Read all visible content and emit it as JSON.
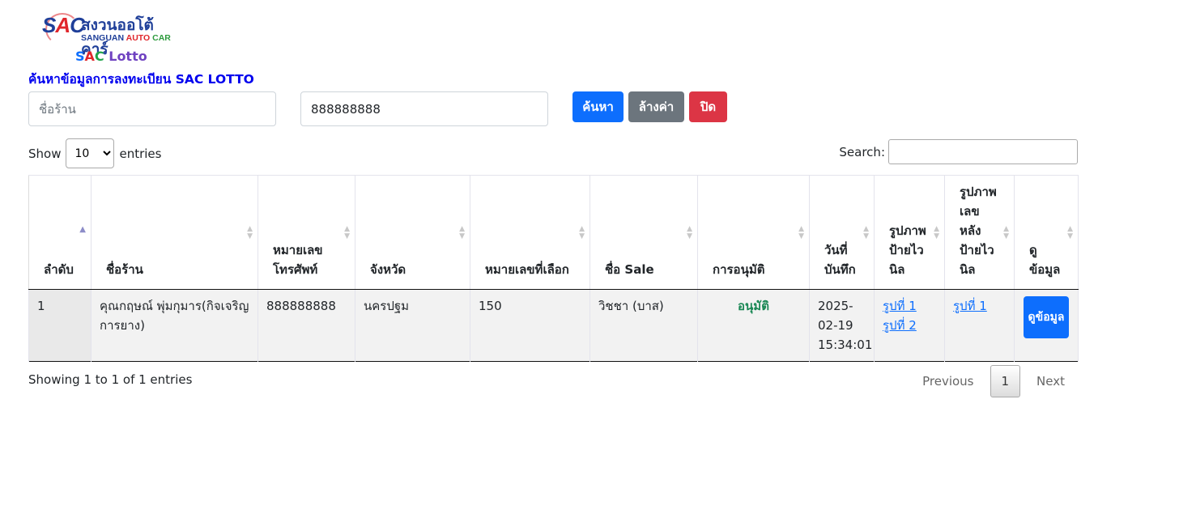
{
  "logo": {
    "mark_s": "S",
    "mark_a": "A",
    "mark_c": "C",
    "thai": "สงวนออโต้คาร์",
    "en_1": "SANGUAN",
    "en_2": "AUTO",
    "en_3": "CAR"
  },
  "brand": {
    "c1": "S",
    "c2": "A",
    "c3": "C",
    "rest": " Lotto"
  },
  "page_title": "ค้นหาข้อมูลการลงทะเบียน SAC LOTTO",
  "search_form": {
    "shop_placeholder": "ชื่อร้าน",
    "shop_value": "",
    "phone_value": "888888888",
    "search_label": "ค้นหา",
    "clear_label": "ล้างค่า",
    "close_label": "ปิด"
  },
  "table_controls": {
    "show_label": "Show",
    "entries_label": "entries",
    "length_options": [
      "10"
    ],
    "length_selected": "10",
    "search_label": "Search:"
  },
  "table": {
    "headers": [
      "ลำดับ",
      "ชื่อร้าน",
      "หมายเลขโทรศัพท์",
      "จังหวัด",
      "หมายเลขที่เลือก",
      "ชื่อ Sale",
      "การอนุมัติ",
      "วันที่บันทึก",
      "รูปภาพป้ายไวนิล",
      "รูปภาพเลขหลังป้ายไวนิล",
      "ดูข้อมูล"
    ],
    "rows": [
      {
        "no": "1",
        "shop": "คุณกฤษณ์ พุ่มกุมาร(กิจเจริญการยาง)",
        "phone": "888888888",
        "province": "นครปฐม",
        "number": "150",
        "sale": "วิชชา (บาส)",
        "approval": "อนุมัติ",
        "date": "2025-02-19 15:34:01",
        "vinyl_link_1": "รูปที่ 1",
        "vinyl_link_2": "รูปที่ 2",
        "back_link_1": "รูปที่ 1",
        "view_label": "ดูข้อมูล"
      }
    ]
  },
  "footer": {
    "info": "Showing 1 to 1 of 1 entries",
    "previous": "Previous",
    "current_page": "1",
    "next": "Next"
  },
  "colors": {
    "primary": "#0d6efd",
    "secondary": "#6c757d",
    "danger": "#dc3545",
    "approved": "#198754",
    "title": "#0000ee"
  }
}
